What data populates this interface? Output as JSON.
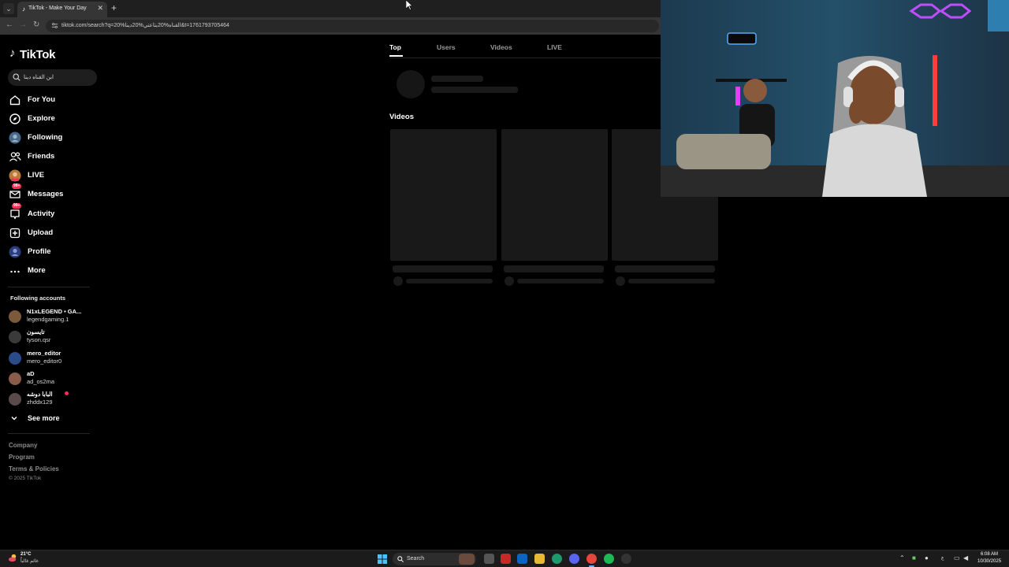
{
  "browser": {
    "tab_title": "TikTok - Make Your Day",
    "tab_close_glyph": "✕",
    "new_tab_glyph": "+",
    "url": "tiktok.com/search?q=20%القناه%20بتاعتي%20دينا&t=1761793705464"
  },
  "sidebar": {
    "logo_text": "TikTok",
    "search_value": "ابن القناه دينا",
    "nav_items": [
      {
        "label": "For You",
        "icon": "home-icon"
      },
      {
        "label": "Explore",
        "icon": "compass-icon"
      },
      {
        "label": "Following",
        "icon": "following-avatar-icon"
      },
      {
        "label": "Friends",
        "icon": "friends-icon"
      },
      {
        "label": "LIVE",
        "icon": "live-icon"
      },
      {
        "label": "Messages",
        "icon": "messages-icon",
        "badge": "99+"
      },
      {
        "label": "Activity",
        "icon": "activity-icon",
        "badge": "99+"
      },
      {
        "label": "Upload",
        "icon": "upload-icon"
      },
      {
        "label": "Profile",
        "icon": "profile-avatar-icon"
      },
      {
        "label": "More",
        "icon": "more-icon"
      }
    ],
    "following_title": "Following accounts",
    "accounts": [
      {
        "name": "N1xLEGEND • GA...",
        "handle": "legendgaming.1",
        "avatar_color": "#7a5a3a"
      },
      {
        "name": "تايسون",
        "handle": "tyson.qsr",
        "avatar_color": "#3a3a3a"
      },
      {
        "name": "mero_editor",
        "handle": "mero_editor0",
        "avatar_color": "#2a4a8a"
      },
      {
        "name": "aD",
        "handle": "ad_os2ma",
        "avatar_color": "#8a5a4a"
      },
      {
        "name": "البابا دوشه",
        "handle": "zhddx129",
        "avatar_color": "#5a4a4a",
        "live": true
      }
    ],
    "see_more": "See more",
    "footer_links": [
      "Company",
      "Program",
      "Terms & Policies"
    ],
    "copyright": "© 2025 TikTok"
  },
  "main": {
    "tabs": [
      "Top",
      "Users",
      "Videos",
      "LIVE"
    ],
    "active_tab": "Top",
    "videos_heading": "Videos"
  },
  "taskbar": {
    "weather_temp": "21°C",
    "weather_condition": "غائم غالباً",
    "search_label": "Search",
    "lang": "ع",
    "time": "6:08 AM",
    "date": "10/30/2025"
  },
  "colors": {
    "accent": "#fe2c55",
    "background": "#000000",
    "skeleton": "#1a1a1a"
  }
}
